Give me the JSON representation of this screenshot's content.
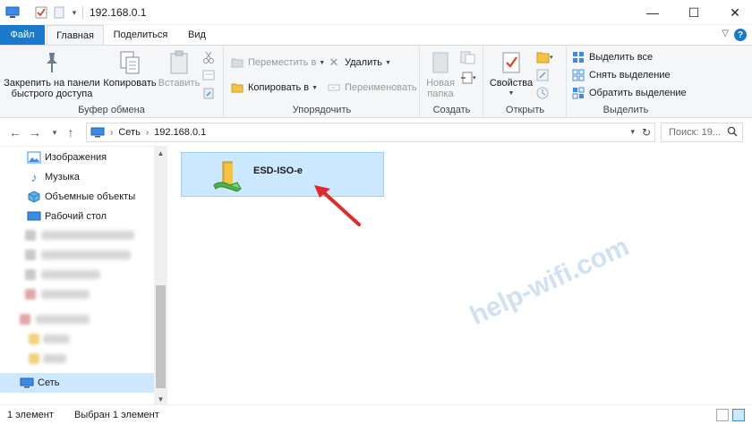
{
  "window": {
    "title": "192.168.0.1",
    "controls": {
      "minimize": "—",
      "maximize": "☐",
      "close": "✕"
    }
  },
  "tabs": {
    "file": "Файл",
    "home": "Главная",
    "share": "Поделиться",
    "view": "Вид"
  },
  "ribbon": {
    "clipboard": {
      "label": "Буфер обмена",
      "pin_line1": "Закрепить на панели",
      "pin_line2": "быстрого доступа",
      "copy": "Копировать",
      "paste": "Вставить"
    },
    "organize": {
      "label": "Упорядочить",
      "move_to": "Переместить в",
      "copy_to": "Копировать в",
      "delete": "Удалить",
      "rename": "Переименовать"
    },
    "create": {
      "label": "Создать",
      "new_folder_line1": "Новая",
      "new_folder_line2": "папка"
    },
    "open": {
      "label": "Открыть",
      "properties": "Свойства"
    },
    "select": {
      "label": "Выделить",
      "select_all": "Выделить все",
      "select_none": "Снять выделение",
      "invert": "Обратить выделение"
    }
  },
  "address": {
    "crumbs": [
      "Сеть",
      "192.168.0.1"
    ],
    "search_placeholder": "Поиск: 19..."
  },
  "nav": {
    "items": [
      "Изображения",
      "Музыка",
      "Объемные объекты",
      "Рабочий стол"
    ],
    "network": "Сеть"
  },
  "content": {
    "items": [
      {
        "name": "ESD-ISO-e"
      }
    ]
  },
  "watermark": "help-wifi.com",
  "status": {
    "count": "1 элемент",
    "selected": "Выбран 1 элемент"
  }
}
